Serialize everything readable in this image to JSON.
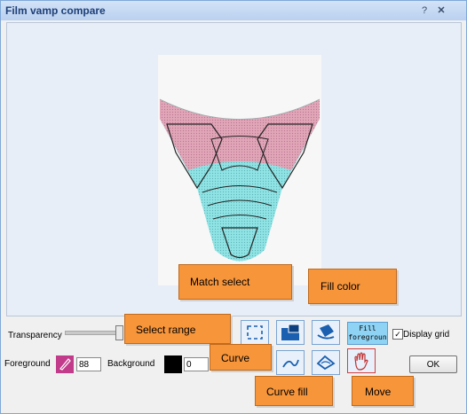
{
  "window": {
    "title": "Film vamp compare",
    "help_glyph": "?",
    "close_glyph": "✕"
  },
  "controls": {
    "transparency_label": "Transparency",
    "fill_foreground_label": "Fill foregroun",
    "display_grid_label": "Display grid",
    "display_grid_checked": true,
    "check_glyph": "✓",
    "foreground_label": "Foreground",
    "foreground_value": "88",
    "foreground_color": "#c13b8a",
    "background_label": "Background",
    "background_value": "0",
    "background_color": "#000000",
    "ok_label": "OK"
  },
  "callouts": {
    "match_select": "Match select",
    "fill_color": "Fill color",
    "select_range": "Select range",
    "curve": "Curve",
    "curve_fill": "Curve fill",
    "move": "Move"
  },
  "colors": {
    "callout": "#f7953b",
    "pink": "#ef9ab0",
    "cyan": "#8fe3e4"
  }
}
